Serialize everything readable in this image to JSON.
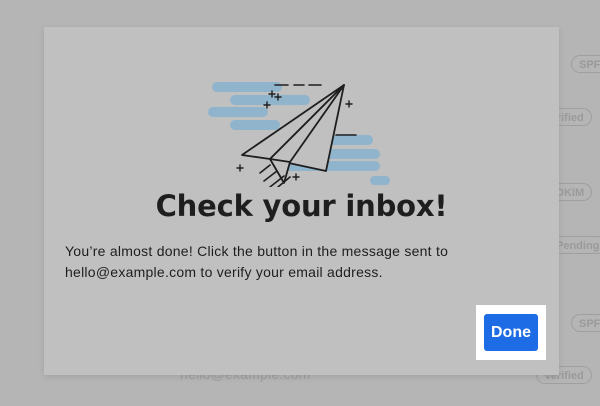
{
  "background": {
    "badges": [
      {
        "label": "SPF"
      },
      {
        "label": "Verified"
      },
      {
        "label": "DKIM"
      },
      {
        "label": "Pending"
      },
      {
        "label": "SPF"
      },
      {
        "label": "Verified"
      }
    ],
    "email_under": "hello@example.com"
  },
  "modal": {
    "title": "Check your inbox!",
    "message": "You’re almost done! Click the button in the message sent to hello@example.com to verify your email address.",
    "done_label": "Done"
  },
  "colors": {
    "accent": "#1e6be6",
    "cloud": "#8fb4cc",
    "overlay": "#b5b5b5",
    "modal": "#c0c0c0"
  },
  "icons": {
    "illustration": "paper-plane-icon"
  }
}
